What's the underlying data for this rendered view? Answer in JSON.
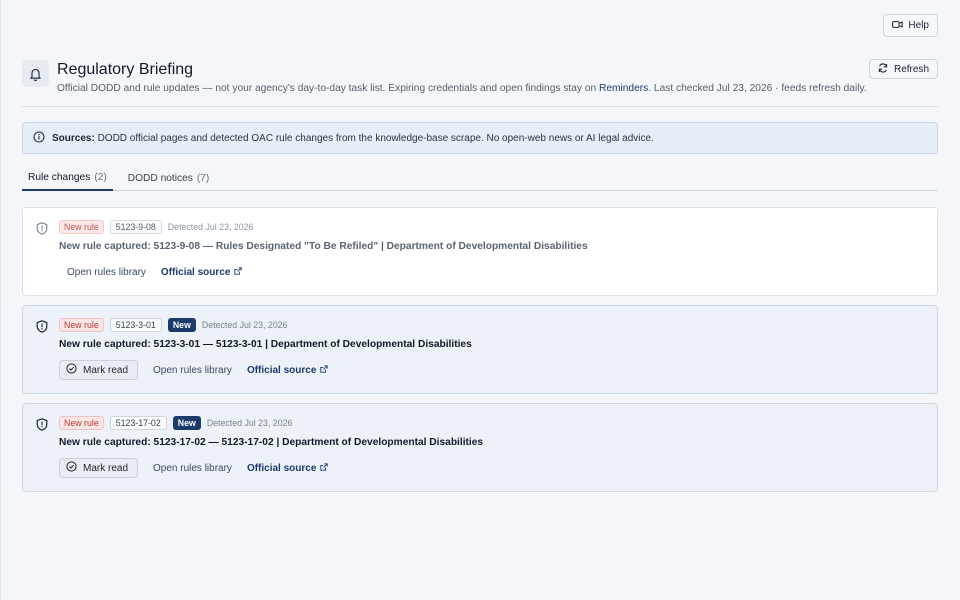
{
  "toolbar": {
    "help_label": "Help",
    "refresh_label": "Refresh"
  },
  "header": {
    "title": "Regulatory Briefing",
    "subtitle_pre": "Official DODD and rule updates — not your agency's day-to-day task list. Expiring credentials and open findings stay on ",
    "reminders_link": "Reminders",
    "subtitle_post": ". Last checked Jul 23, 2026 · feeds refresh daily."
  },
  "sources": {
    "label": "Sources:",
    "text": "DODD official pages and detected OAC rule changes from the knowledge-base scrape. No open-web news or AI legal advice."
  },
  "tabs": [
    {
      "label": "Rule changes",
      "count": "(2)",
      "active": true
    },
    {
      "label": "DODD notices",
      "count": "(7)",
      "active": false
    }
  ],
  "cards": [
    {
      "type_badge": "New rule",
      "code": "5123-9-08",
      "new_badge": "",
      "detected": "Detected Jul 23, 2026",
      "title": "New rule captured: 5123-9-08 — Rules Designated \"To Be Refiled\" | Department of Developmental Disabilities",
      "mark_read": "",
      "library_link": "Open rules library",
      "source_link": "Official source",
      "read": true
    },
    {
      "type_badge": "New rule",
      "code": "5123-3-01",
      "new_badge": "New",
      "detected": "Detected Jul 23, 2026",
      "title": "New rule captured: 5123-3-01 — 5123-3-01 | Department of Developmental Disabilities",
      "mark_read": "Mark read",
      "library_link": "Open rules library",
      "source_link": "Official source",
      "read": false
    },
    {
      "type_badge": "New rule",
      "code": "5123-17-02",
      "new_badge": "New",
      "detected": "Detected Jul 23, 2026",
      "title": "New rule captured: 5123-17-02 — 5123-17-02 | Department of Developmental Disabilities",
      "mark_read": "Mark read",
      "library_link": "Open rules library",
      "source_link": "Official source",
      "read": false
    }
  ],
  "colors": {
    "accent": "#1c3b6a",
    "rule_badge": "#b43a3a",
    "unread_card": "#edf2f9"
  },
  "icons": [
    "camera-icon",
    "refresh-icon",
    "bell-icon",
    "info-icon",
    "shield-icon",
    "check-circle-icon",
    "external-link-icon"
  ]
}
